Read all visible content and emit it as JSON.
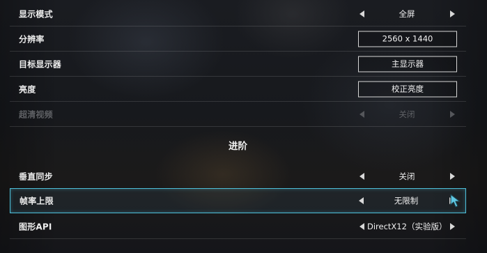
{
  "rows": [
    {
      "label": "显示模式",
      "value": "全屏"
    },
    {
      "label": "分辨率",
      "value": "2560 x 1440"
    },
    {
      "label": "目标显示器",
      "value": "主显示器"
    },
    {
      "label": "亮度",
      "value": "校正亮度"
    },
    {
      "label": "超清视频",
      "value": "关闭"
    }
  ],
  "section": {
    "title": "进阶"
  },
  "advanced": [
    {
      "label": "垂直同步",
      "value": "关闭"
    },
    {
      "label": "帧率上限",
      "value": "无限制"
    },
    {
      "label": "图形API",
      "value": "DirectX12（实验版）"
    }
  ],
  "icons": {
    "left_arrow": "triangle-left",
    "right_arrow": "triangle-right",
    "cursor": "mouse-pointer"
  },
  "colors": {
    "selection_border": "#4ec1db",
    "text": "#ececec",
    "disabled_text": "#5e6064"
  }
}
